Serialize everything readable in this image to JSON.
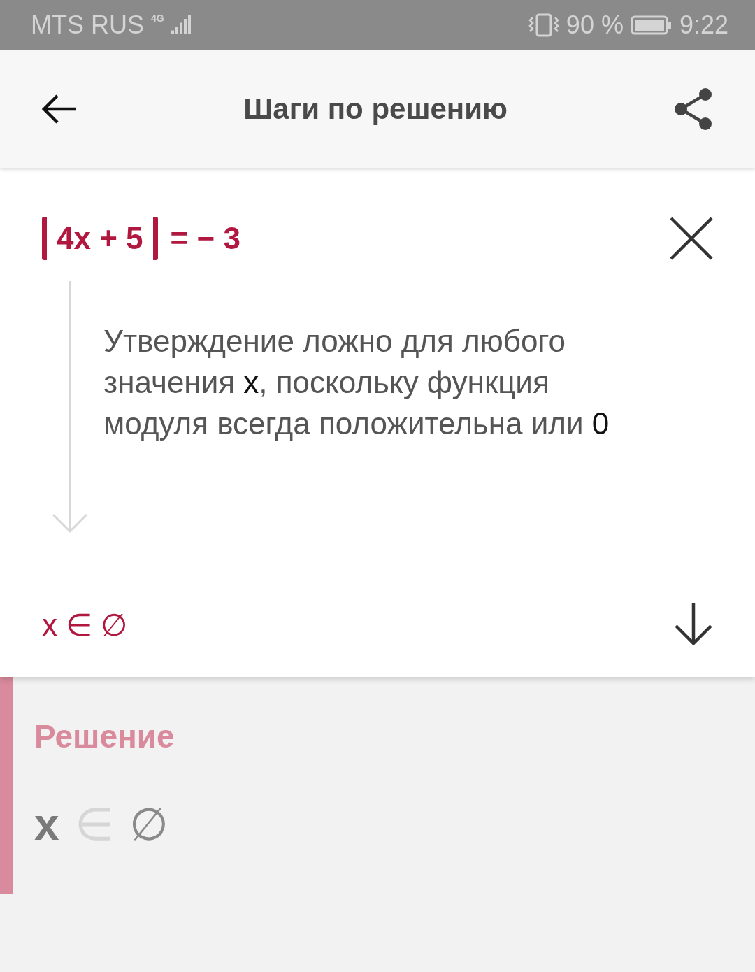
{
  "status_bar": {
    "carrier": "MTS RUS",
    "network": "4G",
    "battery": "90 %",
    "time": "9:22"
  },
  "header": {
    "title": "Шаги по решению"
  },
  "step": {
    "equation": {
      "inside": "4x + 5",
      "right": "= − 3"
    },
    "explanation": [
      {
        "kind": "text",
        "text": "Утверждение ложно для любого значения "
      },
      {
        "kind": "math",
        "text": "x"
      },
      {
        "kind": "text",
        "text": ", поскольку функция модуля всегда положительна или "
      },
      {
        "kind": "math",
        "text": "0"
      }
    ],
    "result": "x ∈ ∅"
  },
  "solution": {
    "title": "Решение",
    "parts": [
      {
        "kind": "variable",
        "text": "x"
      },
      {
        "kind": "operator",
        "text": "∈"
      },
      {
        "kind": "set",
        "text": "∅"
      }
    ]
  }
}
